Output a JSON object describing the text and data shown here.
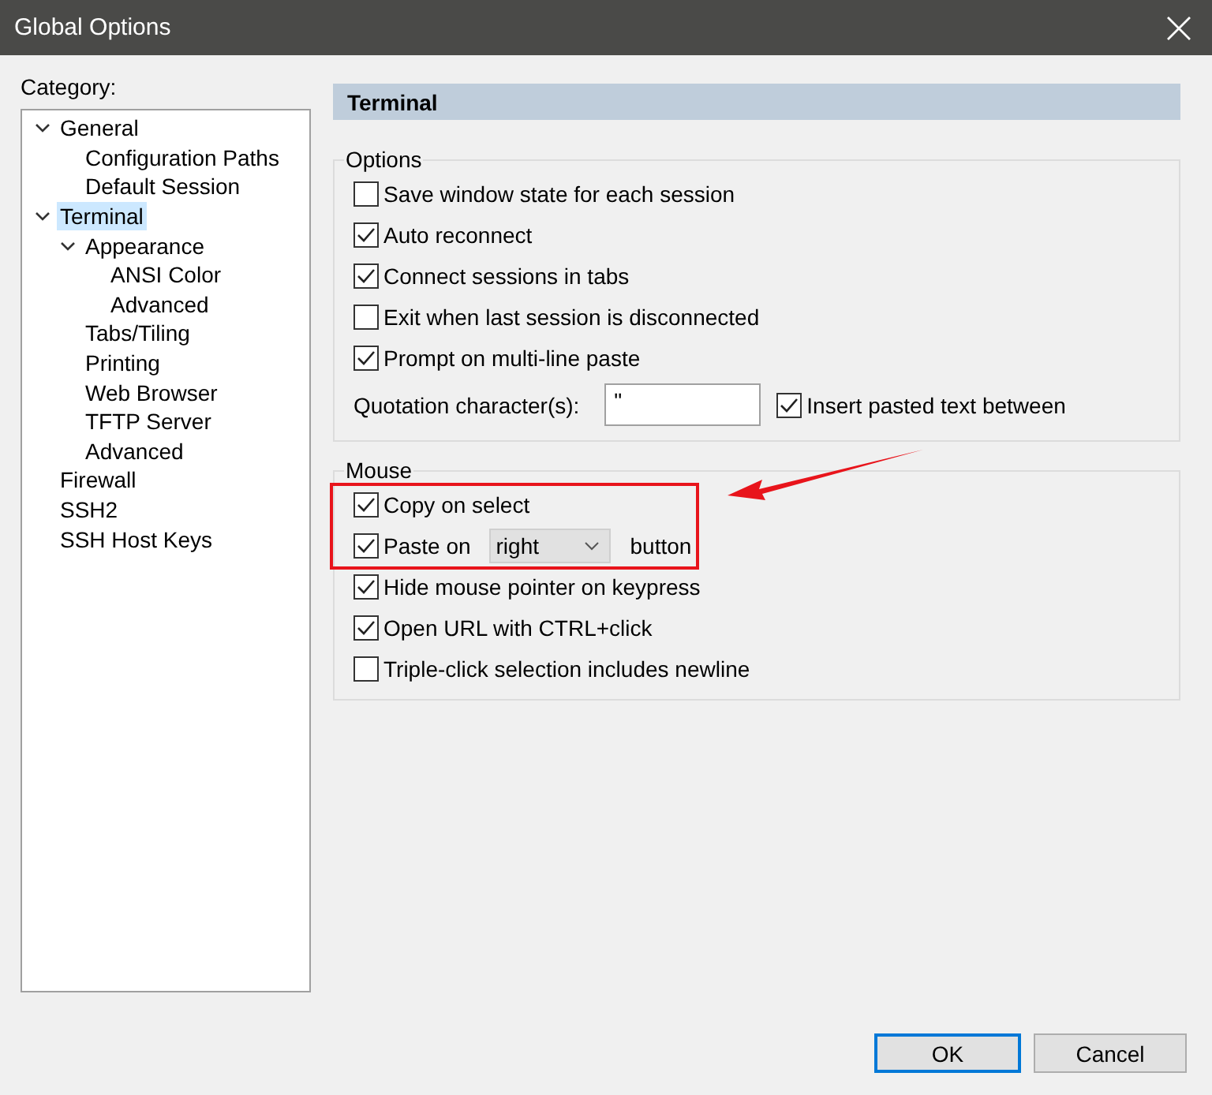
{
  "window": {
    "title": "Global Options"
  },
  "category_label": "Category:",
  "tree": [
    {
      "label": "General",
      "selected": false,
      "expanded": true,
      "children": [
        {
          "label": "Configuration Paths",
          "selected": false
        },
        {
          "label": "Default Session",
          "selected": false
        }
      ]
    },
    {
      "label": "Terminal",
      "selected": true,
      "expanded": true,
      "children": [
        {
          "label": "Appearance",
          "selected": false,
          "expanded": true,
          "children": [
            {
              "label": "ANSI Color",
              "selected": false
            },
            {
              "label": "Advanced",
              "selected": false
            }
          ]
        },
        {
          "label": "Tabs/Tiling",
          "selected": false
        },
        {
          "label": "Printing",
          "selected": false
        },
        {
          "label": "Web Browser",
          "selected": false
        },
        {
          "label": "TFTP Server",
          "selected": false
        },
        {
          "label": "Advanced",
          "selected": false
        }
      ]
    },
    {
      "label": "Firewall",
      "selected": false
    },
    {
      "label": "SSH2",
      "selected": false
    },
    {
      "label": "SSH Host Keys",
      "selected": false
    }
  ],
  "panel": {
    "title": "Terminal",
    "groups": [
      {
        "title": "Options",
        "highlight": false,
        "rows": [
          {
            "kind": "checkbox",
            "label": "Save window state for each session",
            "checked": false
          },
          {
            "kind": "checkbox",
            "label": "Auto reconnect",
            "checked": true
          },
          {
            "kind": "checkbox",
            "label": "Connect sessions in tabs",
            "checked": true
          },
          {
            "kind": "checkbox",
            "label": "Exit when last session is disconnected",
            "checked": false
          },
          {
            "kind": "checkbox",
            "label": "Prompt on multi-line paste",
            "checked": true
          },
          {
            "kind": "quote",
            "label": "Quotation character(s):",
            "field": {
              "value": "\""
            },
            "option": {
              "label": "Insert pasted text between",
              "checked": true
            }
          }
        ]
      },
      {
        "title": "Mouse",
        "highlight": true,
        "rows": [
          {
            "kind": "checkbox",
            "label": "Copy on select",
            "checked": true
          },
          {
            "kind": "dropdown",
            "label": "Paste on",
            "value": "right",
            "suffix": "button",
            "checked": true
          },
          {
            "kind": "checkbox",
            "label": "Hide mouse pointer on keypress",
            "checked": true
          },
          {
            "kind": "checkbox",
            "label": "Open URL with CTRL+click",
            "checked": true
          },
          {
            "kind": "checkbox",
            "label": "Triple-click selection includes newline",
            "checked": false
          }
        ]
      }
    ]
  },
  "buttons": [
    {
      "label": "OK",
      "default": true
    },
    {
      "label": "Cancel",
      "default": false
    }
  ]
}
